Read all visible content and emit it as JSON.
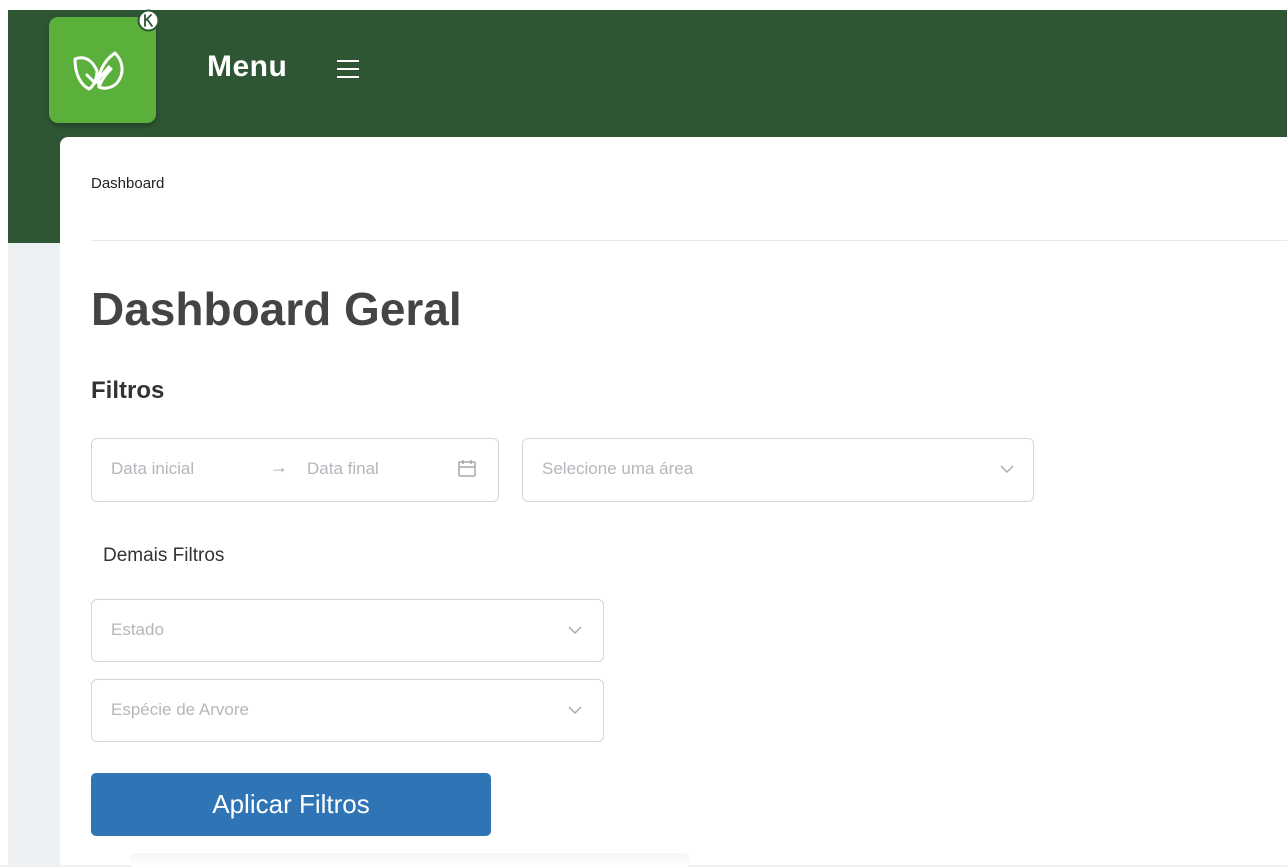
{
  "header": {
    "menu_label": "Menu",
    "logo_icon": "leaf-heart-icon",
    "registered_icon": "registered-mark-icon",
    "menu_icon": "hamburger-icon",
    "background_color": "#2f5634",
    "logo_color": "#5bb03c"
  },
  "breadcrumb": {
    "current": "Dashboard"
  },
  "page": {
    "title": "Dashboard Geral"
  },
  "filters": {
    "heading": "Filtros",
    "date_range": {
      "start_placeholder": "Data inicial",
      "separator": "→",
      "end_placeholder": "Data final",
      "icon": "calendar-icon"
    },
    "area_select": {
      "placeholder": "Selecione uma área",
      "icon": "chevron-down-icon"
    },
    "more_filters_label": "Demais Filtros",
    "estado_select": {
      "placeholder": "Estado",
      "icon": "chevron-down-icon"
    },
    "especie_select": {
      "placeholder": "Espécie de Arvore",
      "icon": "chevron-down-icon"
    },
    "apply_button": {
      "label": "Aplicar Filtros",
      "color": "#2f74b5"
    }
  }
}
